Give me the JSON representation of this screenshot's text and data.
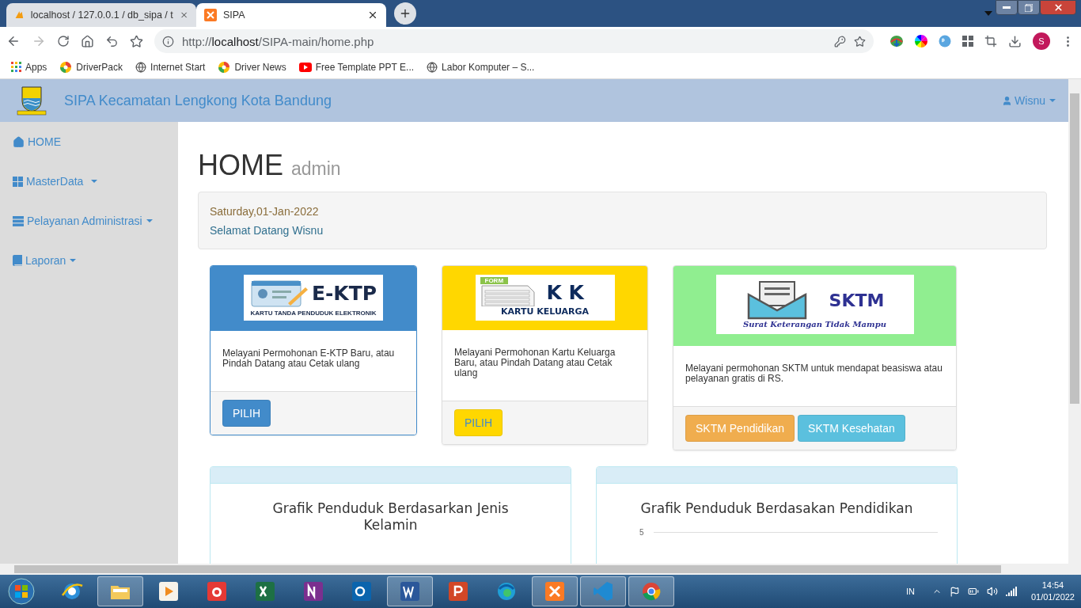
{
  "browser": {
    "tabs": [
      {
        "kind": "pma",
        "title": "localhost / 127.0.0.1 / db_sipa / t",
        "selected": false
      },
      {
        "kind": "xampp",
        "title": "SIPA",
        "selected": true
      }
    ],
    "url_prefix": "http://",
    "url_host": "localhost",
    "url_path": "/SIPA-main/home.php",
    "profile_initial": "S",
    "bookmarks": [
      {
        "kind": "apps",
        "label": "Apps"
      },
      {
        "kind": "driverpack",
        "label": "DriverPack"
      },
      {
        "kind": "globe",
        "label": "Internet Start"
      },
      {
        "kind": "driverpack",
        "label": "Driver News"
      },
      {
        "kind": "youtube",
        "label": "Free Template PPT E..."
      },
      {
        "kind": "globe",
        "label": "Labor Komputer – S..."
      }
    ]
  },
  "navbar": {
    "brand": "SIPA Kecamatan Lengkong Kota Bandung",
    "user": "Wisnu"
  },
  "sidebar": {
    "items": [
      {
        "kind": "home",
        "label": "HOME",
        "caret": false
      },
      {
        "kind": "grid",
        "label": "MasterData",
        "caret": true
      },
      {
        "kind": "server",
        "label": "Pelayanan Administrasi",
        "caret": true
      },
      {
        "kind": "book",
        "label": "Laporan",
        "caret": true
      }
    ]
  },
  "header": {
    "title": "HOME",
    "subtitle": "admin"
  },
  "well": {
    "date": "Saturday,01-Jan-2022",
    "welcome": "Selamat Datang Wisnu"
  },
  "cards": [
    {
      "kind": "ektp",
      "color": "#428bca",
      "banner_title": "E-KTP",
      "banner_subtitle": "KARTU TANDA PENDUDUK ELEKTRONIK",
      "description": "Melayani Permohonan E-KTP Baru, atau Pindah Datang atau Cetak ulang",
      "buttons": [
        {
          "kind": "primary",
          "label": "PILIH"
        }
      ]
    },
    {
      "kind": "kk",
      "color": "#ffd700",
      "form_tag": "FORM",
      "banner_title": "K K",
      "banner_subtitle": "KARTU KELUARGA",
      "description": "Melayani Permohonan Kartu Keluarga Baru, atau Pindah Datang atau Cetak ulang",
      "buttons": [
        {
          "kind": "gold",
          "label": "PILIH"
        }
      ]
    },
    {
      "kind": "sktm",
      "color": "#90ee90",
      "banner_title": "SKTM",
      "banner_subtitle": "Surat Keterangan Tidak Mampu",
      "description": "Melayani permohonan SKTM untuk mendapat beasiswa atau pelayanan gratis di RS.",
      "buttons": [
        {
          "kind": "warning",
          "label": "SKTM Pendidikan"
        },
        {
          "kind": "info",
          "label": "SKTM Kesehatan"
        }
      ]
    }
  ],
  "charts": [
    {
      "title": "Grafik Penduduk Berdasarkan Jenis Kelamin"
    },
    {
      "title": "Grafik Penduduk Berdasakan Pendidikan",
      "axis_label": "5"
    }
  ],
  "taskbar": {
    "apps": [
      {
        "kind": "ie",
        "open": false
      },
      {
        "kind": "explorer",
        "open": true
      },
      {
        "kind": "media",
        "open": false
      },
      {
        "kind": "camera",
        "open": false
      },
      {
        "kind": "excel",
        "open": false
      },
      {
        "kind": "onenote",
        "open": false
      },
      {
        "kind": "outlook",
        "open": false
      },
      {
        "kind": "word",
        "open": true
      },
      {
        "kind": "powerpoint",
        "open": false
      },
      {
        "kind": "edge",
        "open": false
      },
      {
        "kind": "xampp",
        "open": true
      },
      {
        "kind": "vscode",
        "open": true
      },
      {
        "kind": "chrome",
        "open": true
      }
    ],
    "language": "IN",
    "time": "14:54",
    "date": "01/01/2022"
  }
}
